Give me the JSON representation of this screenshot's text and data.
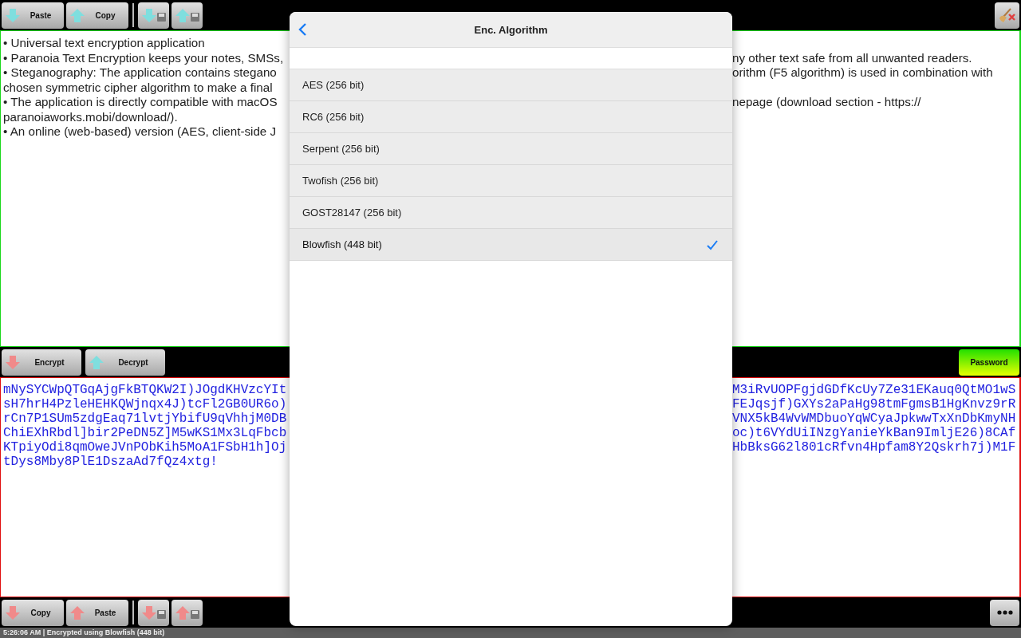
{
  "top_toolbar": {
    "buttons": [
      {
        "label": "Paste",
        "kind": "down",
        "color": "#7fdede"
      },
      {
        "label": "Copy",
        "kind": "up",
        "color": "#7fdede"
      }
    ],
    "save_buttons": [
      {
        "kind": "down",
        "color": "#7fdede"
      },
      {
        "kind": "up",
        "color": "#7fdede"
      }
    ]
  },
  "plain_text": {
    "lines": [
      {
        "left": "• Universal text encryption application"
      },
      {
        "left": "• Paranoia Text Encryption keeps your notes, SMSs,",
        "right": "ny other text safe from all unwanted readers."
      },
      {
        "left": "• Steganography: The application contains stegano",
        "right": "orithm (F5 algorithm) is used in combination with"
      },
      {
        "left": "chosen symmetric cipher algorithm to make a final"
      },
      {
        "left": "• The application is directly compatible with macOS",
        "right": "nepage (download section - https://"
      },
      {
        "left": "paranoiaworks.mobi/download/)."
      },
      {
        "left": "• An online (web-based) version (AES, client-side J"
      }
    ]
  },
  "middle_toolbar": {
    "buttons": [
      {
        "label": "Encrypt",
        "kind": "down",
        "color": "#f08a8a"
      },
      {
        "label": "Decrypt",
        "kind": "up",
        "color": "#7fdede"
      }
    ],
    "password_button": "Password"
  },
  "cipher_text": {
    "lines": [
      {
        "left": "mNySYCWpQTGqAjgFkBTQKW2I)JOgdKHVzcYIt",
        "right": "M3iRvUOPFgjdGDfKcUy7Ze31EKauq0QtMO1wS"
      },
      {
        "left": "sH7hrH4PzleHEHKQWjnqx4J)tcFl2GB0UR6o)",
        "right": "FEJqsjf)GXYs2aPaHg98tmFgmsB1HgKnvz9rR"
      },
      {
        "left": "rCn7P1SUm5zdgEaq71lvtjYbifU9qVhhjM0DB",
        "right": "VNX5kB4WvWMDbuoYqWCyaJpkwwTxXnDbKmyNH"
      },
      {
        "left": "ChiEXhRbdl]bir2PeDN5Z]M5wKS1Mx3LqFbcb",
        "right": "oc)t6VYdUiINzgYanieYkBan9ImljE26)8CAf"
      },
      {
        "left": "KTpiyOdi8qmOweJVnPObKih5MoA1FSbH1h]Oj",
        "right": "HbBksG62l801cRfvn4Hpfam8Y2Qskrh7j)M1F"
      },
      {
        "left": "tDys8Mby8PlE1DszaAd7fQz4xtg!"
      }
    ]
  },
  "bottom_toolbar": {
    "buttons": [
      {
        "label": "Copy",
        "kind": "down",
        "color": "#f08a8a"
      },
      {
        "label": "Paste",
        "kind": "up",
        "color": "#f08a8a"
      }
    ],
    "save_buttons": [
      {
        "kind": "down",
        "color": "#f08a8a"
      },
      {
        "kind": "up",
        "color": "#f08a8a"
      }
    ]
  },
  "status_bar": "5:26:06 AM | Encrypted using Blowfish (448 bit)",
  "popover": {
    "title": "Enc. Algorithm",
    "items": [
      {
        "label": "AES (256 bit)",
        "selected": false
      },
      {
        "label": "RC6 (256 bit)",
        "selected": false
      },
      {
        "label": "Serpent (256 bit)",
        "selected": false
      },
      {
        "label": "Twofish (256 bit)",
        "selected": false
      },
      {
        "label": "GOST28147 (256 bit)",
        "selected": false
      },
      {
        "label": "Blowfish (448 bit)",
        "selected": true
      }
    ]
  }
}
